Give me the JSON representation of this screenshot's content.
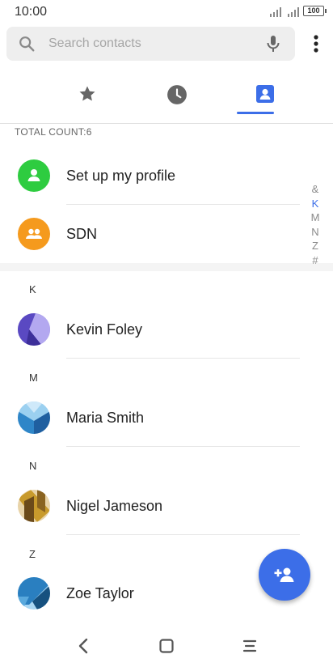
{
  "status_bar": {
    "time": "10:00",
    "battery": "100"
  },
  "search": {
    "placeholder": "Search contacts"
  },
  "tabs": [
    {
      "name": "favorites",
      "icon": "star-icon",
      "active": false
    },
    {
      "name": "recents",
      "icon": "clock-icon",
      "active": false
    },
    {
      "name": "contacts",
      "icon": "contact-card-icon",
      "active": true
    }
  ],
  "total_count": "TOTAL COUNT:6",
  "special_rows": [
    {
      "name": "Set up my profile",
      "icon": "person-icon",
      "color": "#2ecc40"
    },
    {
      "name": "SDN",
      "icon": "group-icon",
      "color": "#f59a1d"
    }
  ],
  "sections": [
    {
      "letter": "K",
      "contact": "Kevin Foley"
    },
    {
      "letter": "M",
      "contact": "Maria Smith"
    },
    {
      "letter": "N",
      "contact": "Nigel Jameson"
    },
    {
      "letter": "Z",
      "contact": "Zoe Taylor"
    }
  ],
  "index_bar": [
    "&",
    "K",
    "M",
    "N",
    "Z",
    "#"
  ],
  "index_active": "K",
  "colors": {
    "accent": "#3c6ee8",
    "profile": "#2ecc40",
    "sdn": "#f59a1d"
  }
}
